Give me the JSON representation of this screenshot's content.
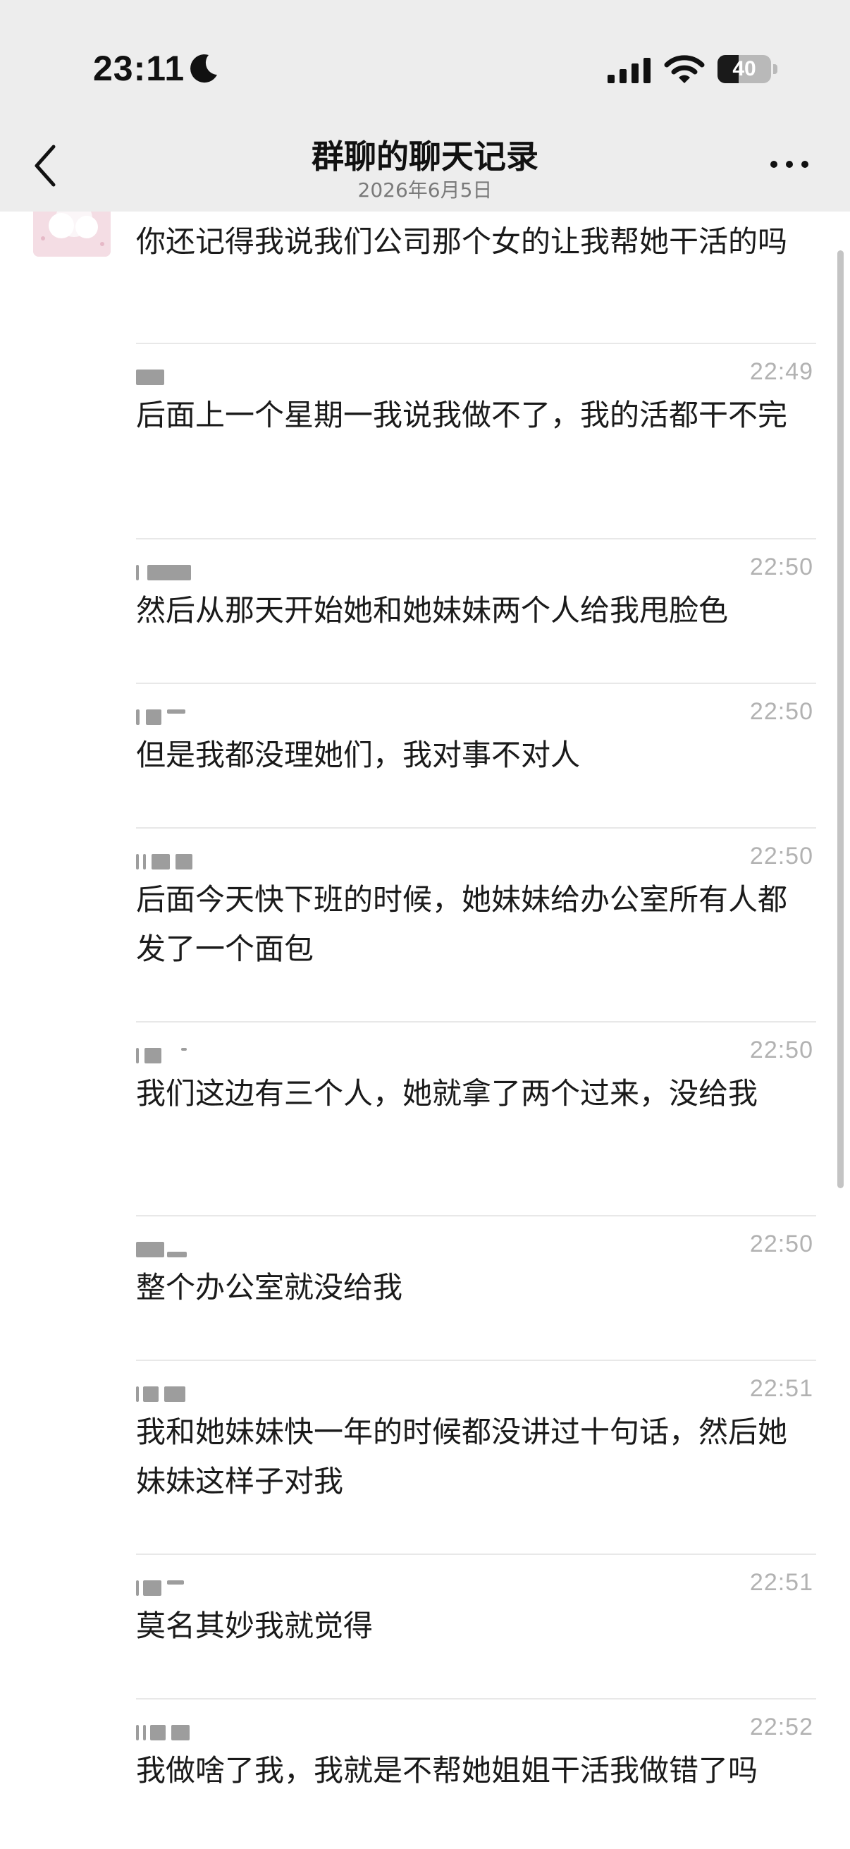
{
  "status_bar": {
    "time": "23:11",
    "battery_level": "40",
    "battery_fraction": 0.4,
    "icons": [
      "moon-icon",
      "signal-icon",
      "wifi-icon",
      "battery-icon"
    ]
  },
  "nav": {
    "title": "群聊的聊天记录",
    "subtitle": "2026年6月5日",
    "back_icon": "chevron-left-icon",
    "more_icon": "more-horizontal-icon"
  },
  "messages": [
    {
      "time": "",
      "text": "你还记得我说我们公司那个女的让我帮她干活的吗"
    },
    {
      "time": "22:49",
      "text": "后面上一个星期一我说我做不了，我的活都干不完"
    },
    {
      "time": "22:50",
      "text": "然后从那天开始她和她妹妹两个人给我甩脸色"
    },
    {
      "time": "22:50",
      "text": "但是我都没理她们，我对事不对人"
    },
    {
      "time": "22:50",
      "text": "后面今天快下班的时候，她妹妹给办公室所有人都发了一个面包"
    },
    {
      "time": "22:50",
      "text": "我们这边有三个人，她就拿了两个过来，没给我"
    },
    {
      "time": "22:50",
      "text": "整个办公室就没给我"
    },
    {
      "time": "22:51",
      "text": "我和她妹妹快一年的时候都没讲过十句话，然后她妹妹这样子对我"
    },
    {
      "time": "22:51",
      "text": "莫名其妙我就觉得"
    },
    {
      "time": "22:52",
      "text": "我做啥了我，我就是不帮她姐姐干活我做错了吗"
    }
  ],
  "colors": {
    "header_bg": "#ededed",
    "text": "#1a1a1a",
    "timestamp": "#b2b2b2",
    "divider": "#e8e8e8",
    "avatar_bg": "#f4dde4"
  }
}
